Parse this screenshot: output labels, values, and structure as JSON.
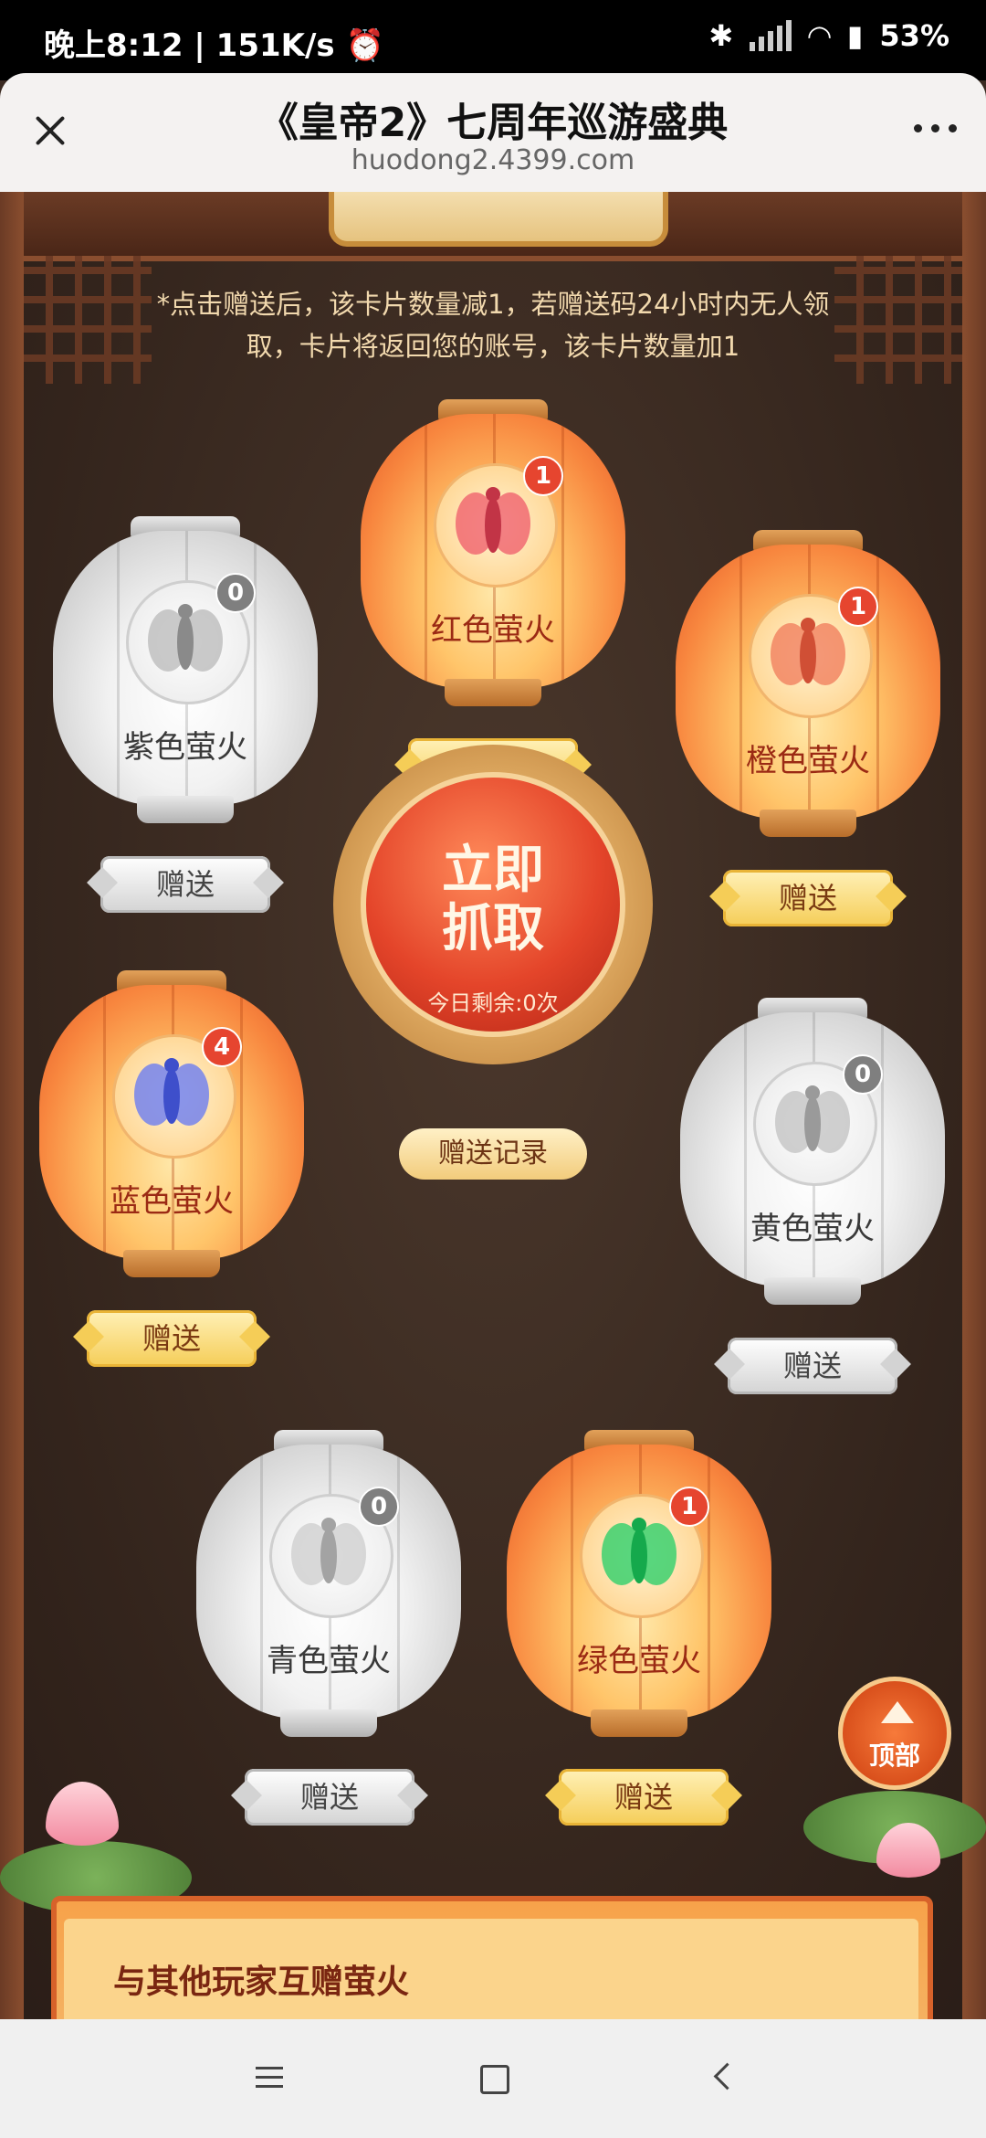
{
  "status_bar": {
    "time_text": "晚上8:12 | 151K/s",
    "battery": "53%",
    "icons": [
      "alarm-icon",
      "bluetooth-icon",
      "signal-icon",
      "wifi-icon",
      "battery-icon"
    ]
  },
  "browser": {
    "title": "《皇帝2》七周年巡游盛典",
    "url": "huodong2.4399.com"
  },
  "notice": "*点击赠送后，该卡片数量减1，若赠送码24小时内无人领取，卡片将返回您的账号，该卡片数量加1",
  "lanterns": [
    {
      "name": "紫色萤火",
      "count": "0",
      "active": false,
      "bug_color": "#9a9a9a",
      "send_label": "赠送"
    },
    {
      "name": "红色萤火",
      "count": "1",
      "active": true,
      "bug_color": "#ef5a6a",
      "send_label": "赠送"
    },
    {
      "name": "橙色萤火",
      "count": "1",
      "active": true,
      "bug_color": "#f07a5a",
      "send_label": "赠送"
    },
    {
      "name": "蓝色萤火",
      "count": "4",
      "active": true,
      "bug_color": "#6d7df0",
      "send_label": "赠送"
    },
    {
      "name": "黄色萤火",
      "count": "0",
      "active": false,
      "bug_color": "#a8a8a8",
      "send_label": "赠送"
    },
    {
      "name": "青色萤火",
      "count": "0",
      "active": false,
      "bug_color": "#b0b0b0",
      "send_label": "赠送"
    },
    {
      "name": "绿色萤火",
      "count": "1",
      "active": true,
      "bug_color": "#2fd06a",
      "send_label": "赠送"
    }
  ],
  "grab": {
    "line1": "立即",
    "line2": "抓取",
    "remaining": "今日剩余:0次"
  },
  "record_button": "赠送记录",
  "top_button": "顶部",
  "panel_title": "与其他玩家互赠萤火",
  "colors": {
    "accent_red": "#e4452a",
    "gold": "#f5cd57",
    "background": "#33241c"
  }
}
